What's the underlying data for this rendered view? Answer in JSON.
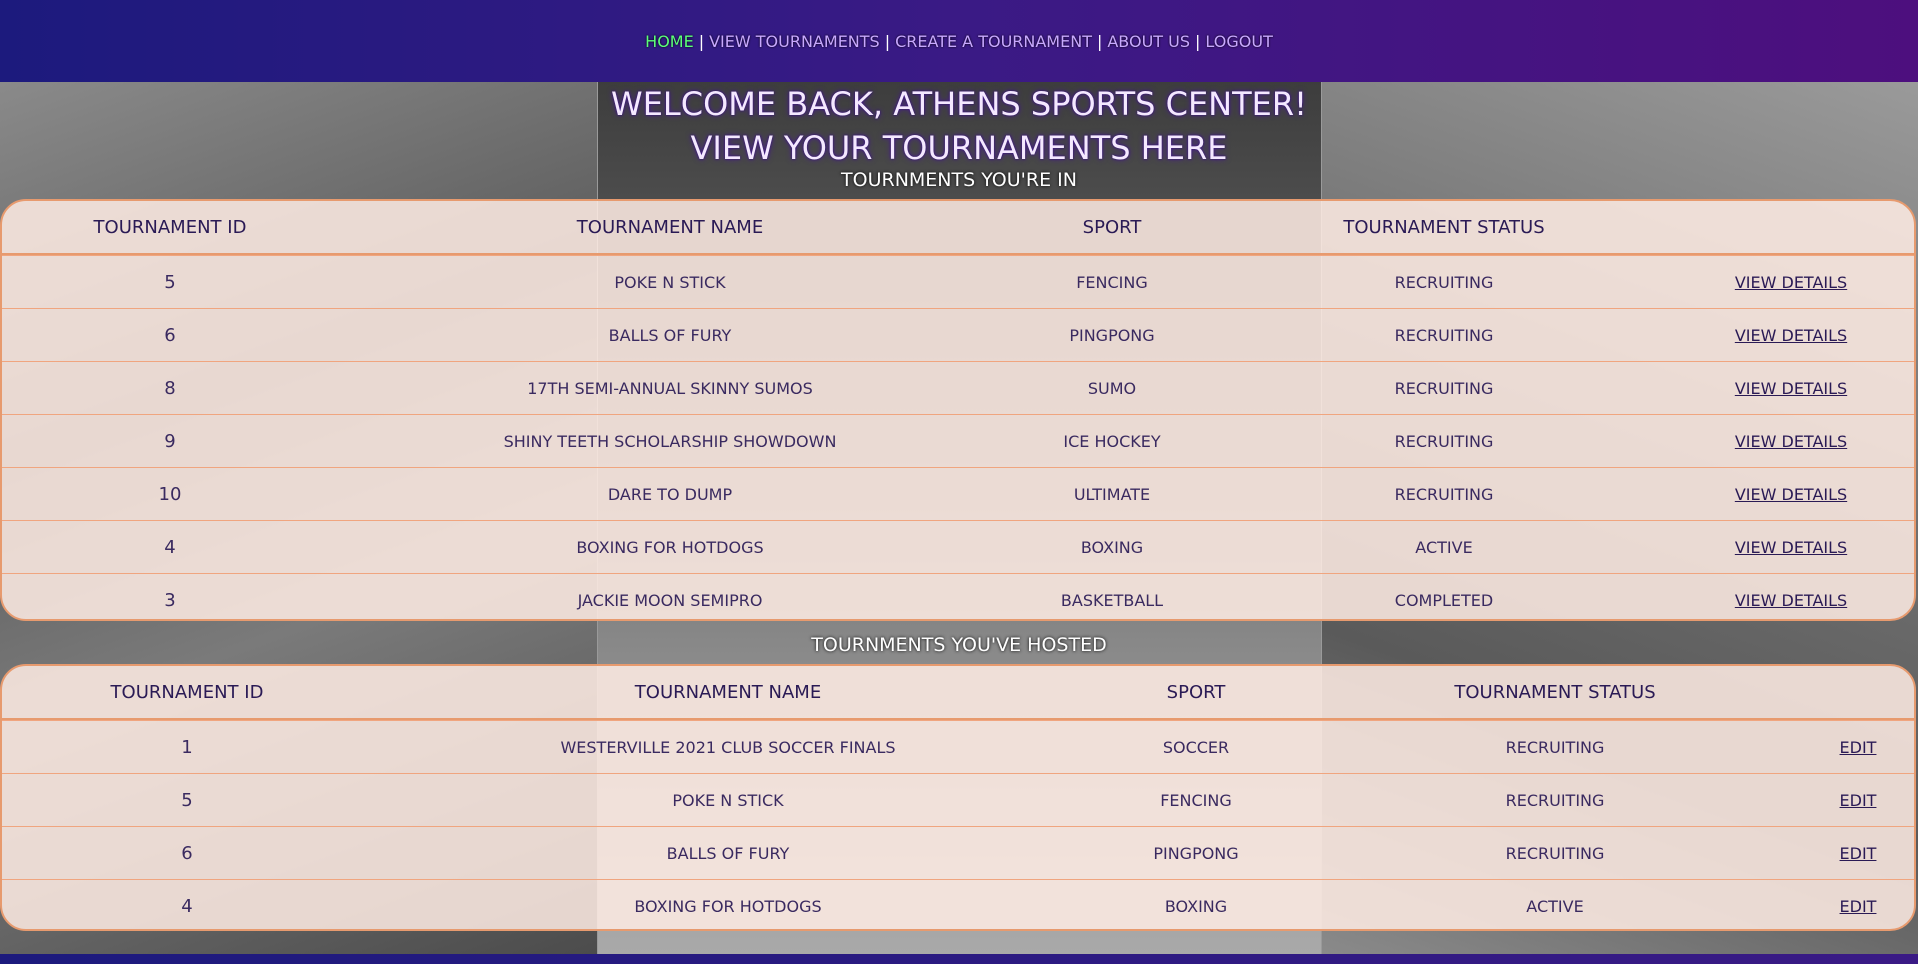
{
  "nav": {
    "items": [
      {
        "label": "HOME",
        "active": true
      },
      {
        "label": "VIEW TOURNAMENTS",
        "active": false
      },
      {
        "label": "CREATE A TOURNAMENT",
        "active": false
      },
      {
        "label": "ABOUT US",
        "active": false
      },
      {
        "label": "LOGOUT",
        "active": false
      }
    ],
    "separator": "|"
  },
  "welcome": {
    "line1": "WELCOME BACK, ATHENS SPORTS CENTER!",
    "line2": "VIEW YOUR TOURNAMENTS HERE"
  },
  "joined": {
    "title": "TOURNMENTS YOU'RE IN",
    "headers": [
      "TOURNAMENT ID",
      "TOURNAMENT NAME",
      "SPORT",
      "TOURNAMENT STATUS"
    ],
    "action_label": "VIEW DETAILS",
    "rows": [
      {
        "id": "5",
        "name": "POKE N STICK",
        "sport": "FENCING",
        "status": "RECRUITING"
      },
      {
        "id": "6",
        "name": "BALLS OF FURY",
        "sport": "PINGPONG",
        "status": "RECRUITING"
      },
      {
        "id": "8",
        "name": "17TH SEMI-ANNUAL SKINNY SUMOS",
        "sport": "SUMO",
        "status": "RECRUITING"
      },
      {
        "id": "9",
        "name": "SHINY TEETH SCHOLARSHIP SHOWDOWN",
        "sport": "ICE HOCKEY",
        "status": "RECRUITING"
      },
      {
        "id": "10",
        "name": "DARE TO DUMP",
        "sport": "ULTIMATE",
        "status": "RECRUITING"
      },
      {
        "id": "4",
        "name": "BOXING FOR HOTDOGS",
        "sport": "BOXING",
        "status": "ACTIVE"
      },
      {
        "id": "3",
        "name": "JACKIE MOON SEMIPRO",
        "sport": "BASKETBALL",
        "status": "COMPLETED"
      }
    ]
  },
  "hosted": {
    "title": "TOURNMENTS YOU'VE HOSTED",
    "headers": [
      "TOURNAMENT ID",
      "TOURNAMENT NAME",
      "SPORT",
      "TOURNAMENT STATUS"
    ],
    "action_label": "EDIT",
    "rows": [
      {
        "id": "1",
        "name": "WESTERVILLE 2021 CLUB SOCCER FINALS",
        "sport": "SOCCER",
        "status": "RECRUITING"
      },
      {
        "id": "5",
        "name": "POKE N STICK",
        "sport": "FENCING",
        "status": "RECRUITING"
      },
      {
        "id": "6",
        "name": "BALLS OF FURY",
        "sport": "PINGPONG",
        "status": "RECRUITING"
      },
      {
        "id": "4",
        "name": "BOXING FOR HOTDOGS",
        "sport": "BOXING",
        "status": "ACTIVE"
      }
    ]
  },
  "colors": {
    "nav_active": "#5cff7a",
    "nav_link": "#c8a8ff",
    "table_border": "#e79a6e",
    "table_bg": "#ffece4",
    "text": "#2a1a55"
  }
}
